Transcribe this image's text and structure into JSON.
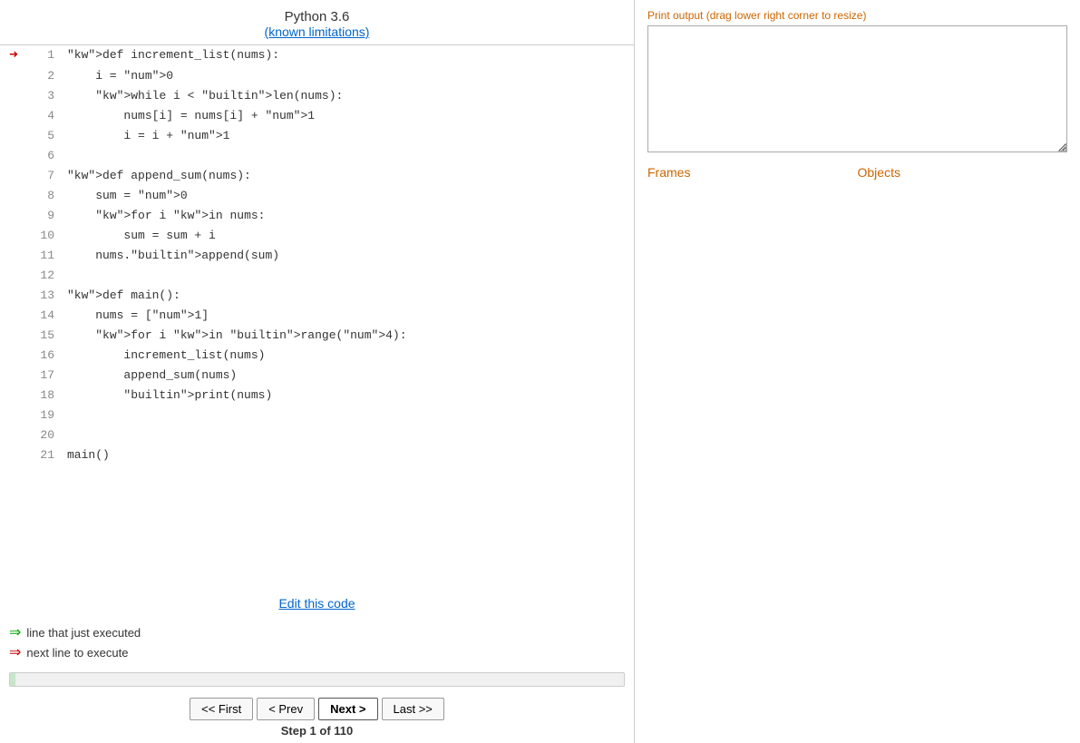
{
  "header": {
    "title": "Python 3.6",
    "link_text": "(known limitations)"
  },
  "code_lines": [
    {
      "num": 1,
      "arrow": "red",
      "code": "def increment_list(nums):"
    },
    {
      "num": 2,
      "arrow": "",
      "code": "    i = 0"
    },
    {
      "num": 3,
      "arrow": "",
      "code": "    while i < len(nums):"
    },
    {
      "num": 4,
      "arrow": "",
      "code": "        nums[i] = nums[i] + 1"
    },
    {
      "num": 5,
      "arrow": "",
      "code": "        i = i + 1"
    },
    {
      "num": 6,
      "arrow": "",
      "code": ""
    },
    {
      "num": 7,
      "arrow": "",
      "code": "def append_sum(nums):"
    },
    {
      "num": 8,
      "arrow": "",
      "code": "    sum = 0"
    },
    {
      "num": 9,
      "arrow": "",
      "code": "    for i in nums:"
    },
    {
      "num": 10,
      "arrow": "",
      "code": "        sum = sum + i"
    },
    {
      "num": 11,
      "arrow": "",
      "code": "    nums.append(sum)"
    },
    {
      "num": 12,
      "arrow": "",
      "code": ""
    },
    {
      "num": 13,
      "arrow": "",
      "code": "def main():"
    },
    {
      "num": 14,
      "arrow": "",
      "code": "    nums = [1]"
    },
    {
      "num": 15,
      "arrow": "",
      "code": "    for i in range(4):"
    },
    {
      "num": 16,
      "arrow": "",
      "code": "        increment_list(nums)"
    },
    {
      "num": 17,
      "arrow": "",
      "code": "        append_sum(nums)"
    },
    {
      "num": 18,
      "arrow": "",
      "code": "        print(nums)"
    },
    {
      "num": 19,
      "arrow": "",
      "code": ""
    },
    {
      "num": 20,
      "arrow": "",
      "code": ""
    },
    {
      "num": 21,
      "arrow": "",
      "code": "main()"
    }
  ],
  "edit_link": "Edit this code",
  "legend": {
    "green_text": "line that just executed",
    "red_text": "next line to execute"
  },
  "nav": {
    "first": "<< First",
    "prev": "< Prev",
    "next": "Next >",
    "last": "Last >>"
  },
  "step": {
    "current": 1,
    "total": 110,
    "label": "Step 1 of 110"
  },
  "right_panel": {
    "print_output_label": "Print output (drag lower right corner to resize)",
    "frames_label": "Frames",
    "objects_label": "Objects"
  }
}
